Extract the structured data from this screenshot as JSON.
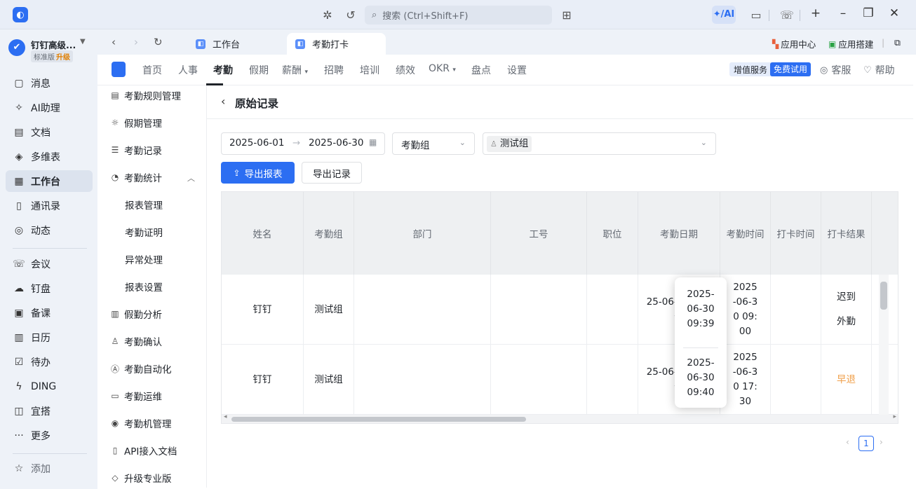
{
  "titlebar": {
    "search_placeholder": "搜索 (Ctrl+Shift+F)",
    "ai_label": "✦/AI"
  },
  "org": {
    "name": "钉钉高级...",
    "tier": "标准版",
    "upgrade": "升级"
  },
  "leftnav": [
    {
      "label": "消息",
      "icon": "message-icon"
    },
    {
      "label": "AI助理",
      "icon": "ai-assistant-icon"
    },
    {
      "label": "文档",
      "icon": "document-icon"
    },
    {
      "label": "多维表",
      "icon": "multi-table-icon"
    },
    {
      "label": "工作台",
      "icon": "workbench-icon",
      "active": true
    },
    {
      "label": "通讯录",
      "icon": "contacts-icon"
    },
    {
      "label": "动态",
      "icon": "feed-icon"
    },
    {
      "label": "会议",
      "icon": "meeting-icon"
    },
    {
      "label": "钉盘",
      "icon": "drive-icon"
    },
    {
      "label": "备课",
      "icon": "lesson-prep-icon"
    },
    {
      "label": "日历",
      "icon": "calendar-icon"
    },
    {
      "label": "待办",
      "icon": "todo-icon"
    },
    {
      "label": "DING",
      "icon": "ding-icon"
    },
    {
      "label": "宜搭",
      "icon": "yida-icon"
    },
    {
      "label": "更多",
      "icon": "more-icon"
    },
    {
      "label": "添加",
      "icon": "add-pin-icon"
    }
  ],
  "tabs": [
    {
      "label": "工作台"
    },
    {
      "label": "考勤打卡",
      "active": true
    }
  ],
  "tab_right": {
    "app_center": "应用中心",
    "app_builder": "应用搭建"
  },
  "topnav": {
    "items": [
      "首页",
      "人事",
      "考勤",
      "假期",
      "薪酬",
      "招聘",
      "培训",
      "绩效",
      "OKR",
      "盘点",
      "设置"
    ],
    "active": "考勤",
    "value_added": "增值服务",
    "free_trial": "免费试用",
    "service": "客服",
    "help": "帮助"
  },
  "sidemenu": {
    "items": [
      {
        "label": "考勤规则管理"
      },
      {
        "label": "假期管理"
      },
      {
        "label": "考勤记录"
      },
      {
        "label": "考勤统计"
      },
      {
        "label": "报表管理"
      },
      {
        "label": "考勤证明"
      },
      {
        "label": "异常处理"
      },
      {
        "label": "报表设置"
      },
      {
        "label": "假勤分析"
      },
      {
        "label": "考勤确认"
      },
      {
        "label": "考勤自动化"
      },
      {
        "label": "考勤运维"
      },
      {
        "label": "考勤机管理"
      },
      {
        "label": "API接入文档"
      },
      {
        "label": "升级专业版"
      }
    ]
  },
  "page": {
    "title": "原始记录",
    "date_start": "2025-06-01",
    "date_end": "2025-06-30",
    "group_select": "考勤组",
    "group_tag": "测试组",
    "export_report": "导出报表",
    "export_record": "导出记录"
  },
  "table": {
    "headers": [
      "姓名",
      "考勤组",
      "部门",
      "工号",
      "职位",
      "考勤日期",
      "考勤时间",
      "打卡时间",
      "打卡结果"
    ],
    "rows": [
      {
        "name": "钉钉",
        "group": "测试组",
        "dept": "",
        "empno": "",
        "position": "",
        "date": "25-06-30 星期一",
        "time": "2025-06-30 09:00",
        "punch": "2025-06-30 09:39",
        "result1": "迟到",
        "result2": "外勤"
      },
      {
        "name": "钉钉",
        "group": "测试组",
        "dept": "",
        "empno": "",
        "position": "",
        "date": "25-06-30 星期一",
        "time": "2025-06-30 17:30",
        "punch": "2025-06-30 09:40",
        "result1": "早退",
        "result2": ""
      }
    ]
  },
  "pager": {
    "current": "1"
  },
  "colors": {
    "accent": "#2c6ef2",
    "early_leave": "#f0a04b"
  }
}
